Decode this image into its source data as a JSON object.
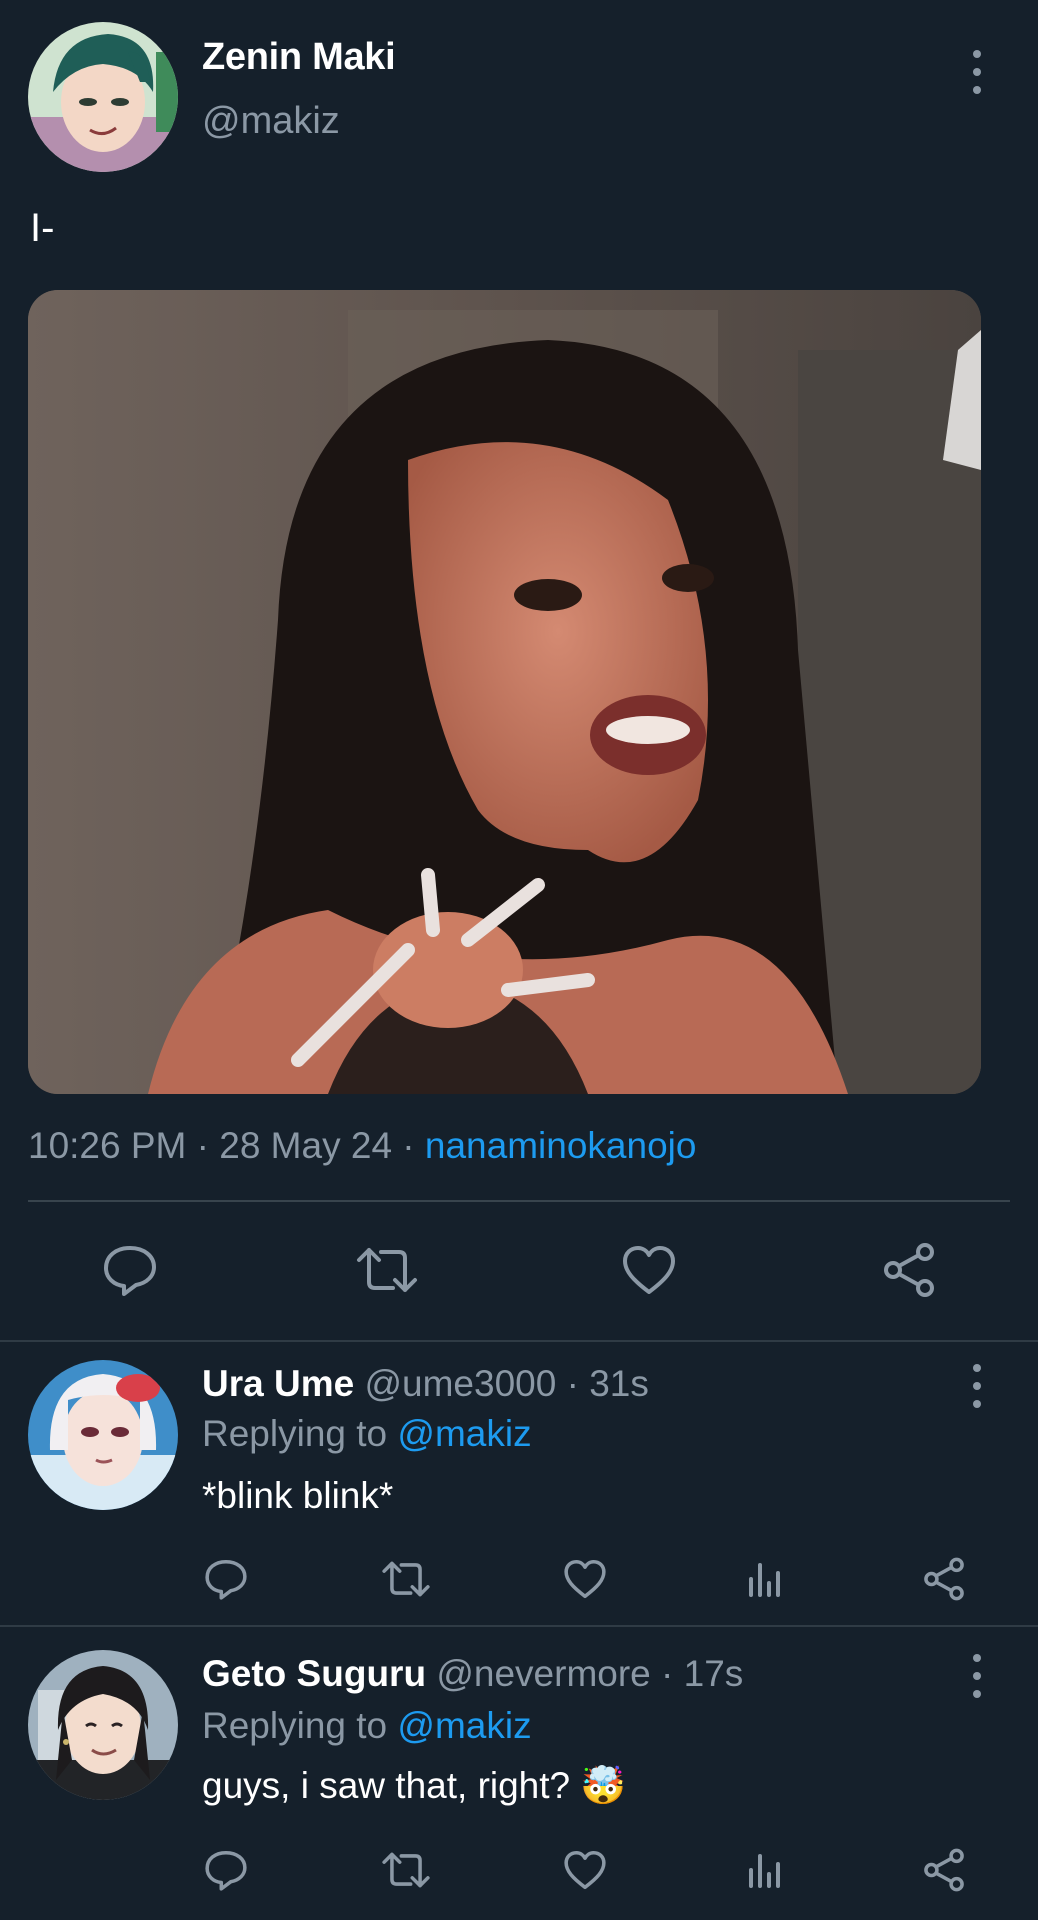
{
  "tweet": {
    "author_name": "Zenin Maki",
    "author_handle": "@makiz",
    "text": "I-",
    "time": "10:26 PM · 28 May 24 · ",
    "source": "nanaminokanojo"
  },
  "replies": [
    {
      "name": "Ura Ume",
      "meta": "@ume3000 · 31s",
      "replying_prefix": "Replying to ",
      "replying_to": "@makiz",
      "body": "*blink blink*"
    },
    {
      "name": "Geto Suguru",
      "meta": "@nevermore · 17s",
      "replying_prefix": "Replying to ",
      "replying_to": "@makiz",
      "body": "guys, i saw that, right?",
      "emoji": "🤯"
    }
  ],
  "colors": {
    "background": "#15202b",
    "muted": "#8b98a5",
    "link": "#1d9bf0",
    "divider": "#38444d"
  },
  "icons": [
    "more-vertical-icon",
    "reply-icon",
    "retweet-icon",
    "like-icon",
    "share-icon",
    "analytics-icon"
  ]
}
